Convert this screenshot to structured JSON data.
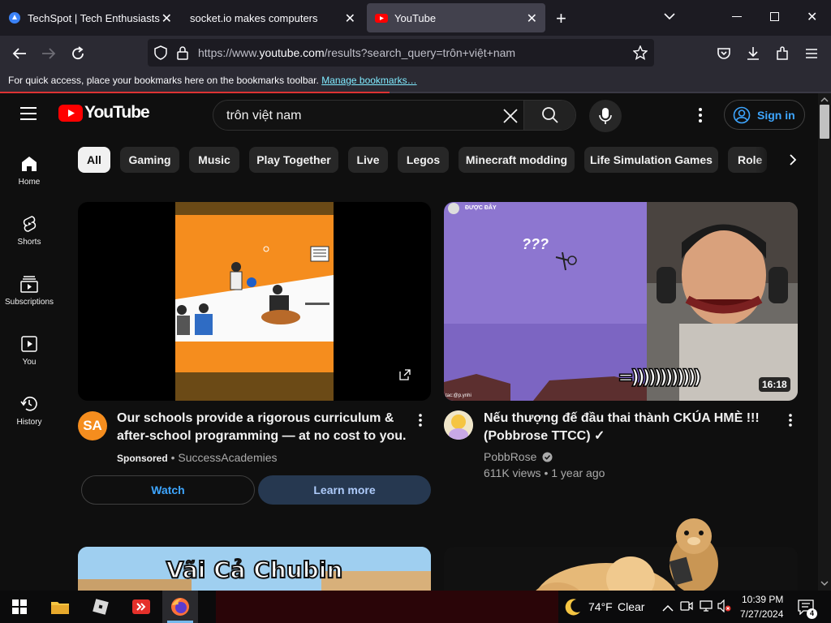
{
  "browser": {
    "tabs": [
      {
        "title": "TechSpot | Tech Enthusiasts, Po",
        "active": false
      },
      {
        "title": "socket.io makes computers",
        "active": false
      },
      {
        "title": "YouTube",
        "active": true
      }
    ],
    "url_prefix": "https://www.",
    "url_domain": "youtube.com",
    "url_rest": "/results?search_query=trôn+việt+nam",
    "bookmarks_text": "For quick access, place your bookmarks here on the bookmarks toolbar.",
    "bookmarks_link": "Manage bookmarks…"
  },
  "youtube": {
    "logo_text": "YouTube",
    "search_query": "trôn việt nam",
    "sign_in": "Sign in",
    "chips": [
      "All",
      "Gaming",
      "Music",
      "Play Together",
      "Live",
      "Legos",
      "Minecraft modding",
      "Life Simulation Games",
      "Role"
    ],
    "sidebar": [
      {
        "label": "Home",
        "icon": "home-icon"
      },
      {
        "label": "Shorts",
        "icon": "shorts-icon"
      },
      {
        "label": "Subscriptions",
        "icon": "subscriptions-icon"
      },
      {
        "label": "You",
        "icon": "you-icon"
      },
      {
        "label": "History",
        "icon": "history-icon"
      }
    ],
    "ad": {
      "avatar_text": "SA",
      "title": "Our schools provide a rigorous curriculum & after-school programming — at no cost to you.",
      "sponsored": "Sponsored",
      "advertiser": "SuccessAcademies",
      "watch": "Watch",
      "learn_more": "Learn more"
    },
    "video1": {
      "title": "Nếu thượng đế đầu thai thành CKÚA HMÈ !!! (Pobbrose TTCC) ✓",
      "channel": "PobbRose",
      "views": "611K views",
      "age": "1 year ago",
      "duration": "16:18",
      "overlay_top": "ĐƯỢC ĐÂY",
      "overlay_q": "???",
      "overlay_laugh": "=))))))))))))",
      "overlay_credit": "tac:@p.ynhi"
    },
    "video2": {
      "thumb_text": "Vãi Cả Chubin"
    }
  },
  "taskbar": {
    "weather_temp": "74°F",
    "weather_desc": "Clear",
    "time": "10:39 PM",
    "date": "7/27/2024",
    "notif_count": "4"
  },
  "colors": {
    "yt_red": "#ff0000",
    "link_blue": "#3ea6ff",
    "learn_bg": "#263850",
    "learn_fg": "#aecbfa",
    "orange": "#f58d1e",
    "purple": "#8d76d0"
  }
}
